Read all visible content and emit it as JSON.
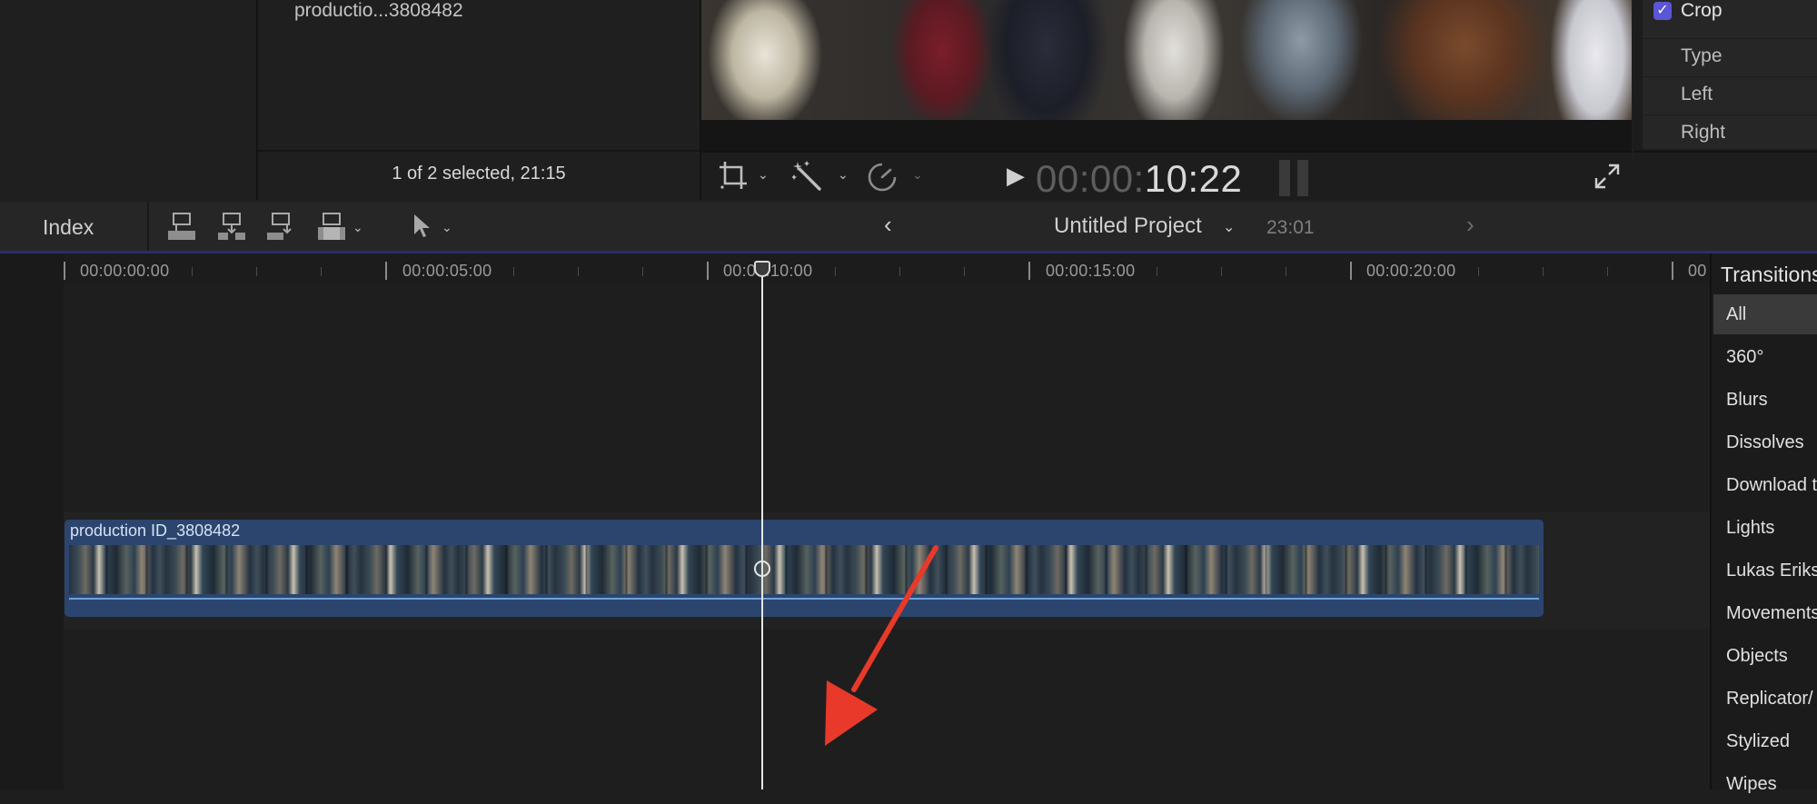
{
  "browser": {
    "clip_name": "productio...3808482",
    "status": "1 of 2 selected, 21:15"
  },
  "viewer": {
    "timecode_dim": "00:00:",
    "timecode_bright": "10:22"
  },
  "inspector": {
    "crop_label": "Crop",
    "rows": [
      "Type",
      "Left",
      "Right"
    ]
  },
  "timeline_toolbar": {
    "index_label": "Index",
    "project_name": "Untitled Project",
    "project_duration": "23:01"
  },
  "ruler": {
    "labels": [
      "00:00:00:00",
      "00:00:05:00",
      "00:00:10:00",
      "00:00:15:00",
      "00:00:20:00",
      "00"
    ]
  },
  "clip": {
    "name": "production ID_3808482"
  },
  "transitions": {
    "title": "Transitions",
    "items": [
      "All",
      "360°",
      "Blurs",
      "Dissolves",
      "Download t",
      "Lights",
      "Lukas Eriks",
      "Movements",
      "Objects",
      "Replicator/",
      "Stylized",
      "Wipes"
    ],
    "selected": "All"
  },
  "colors": {
    "accent": "#5b56d6",
    "clip_blue": "#2c456e",
    "arrow_red": "#e8392a"
  }
}
